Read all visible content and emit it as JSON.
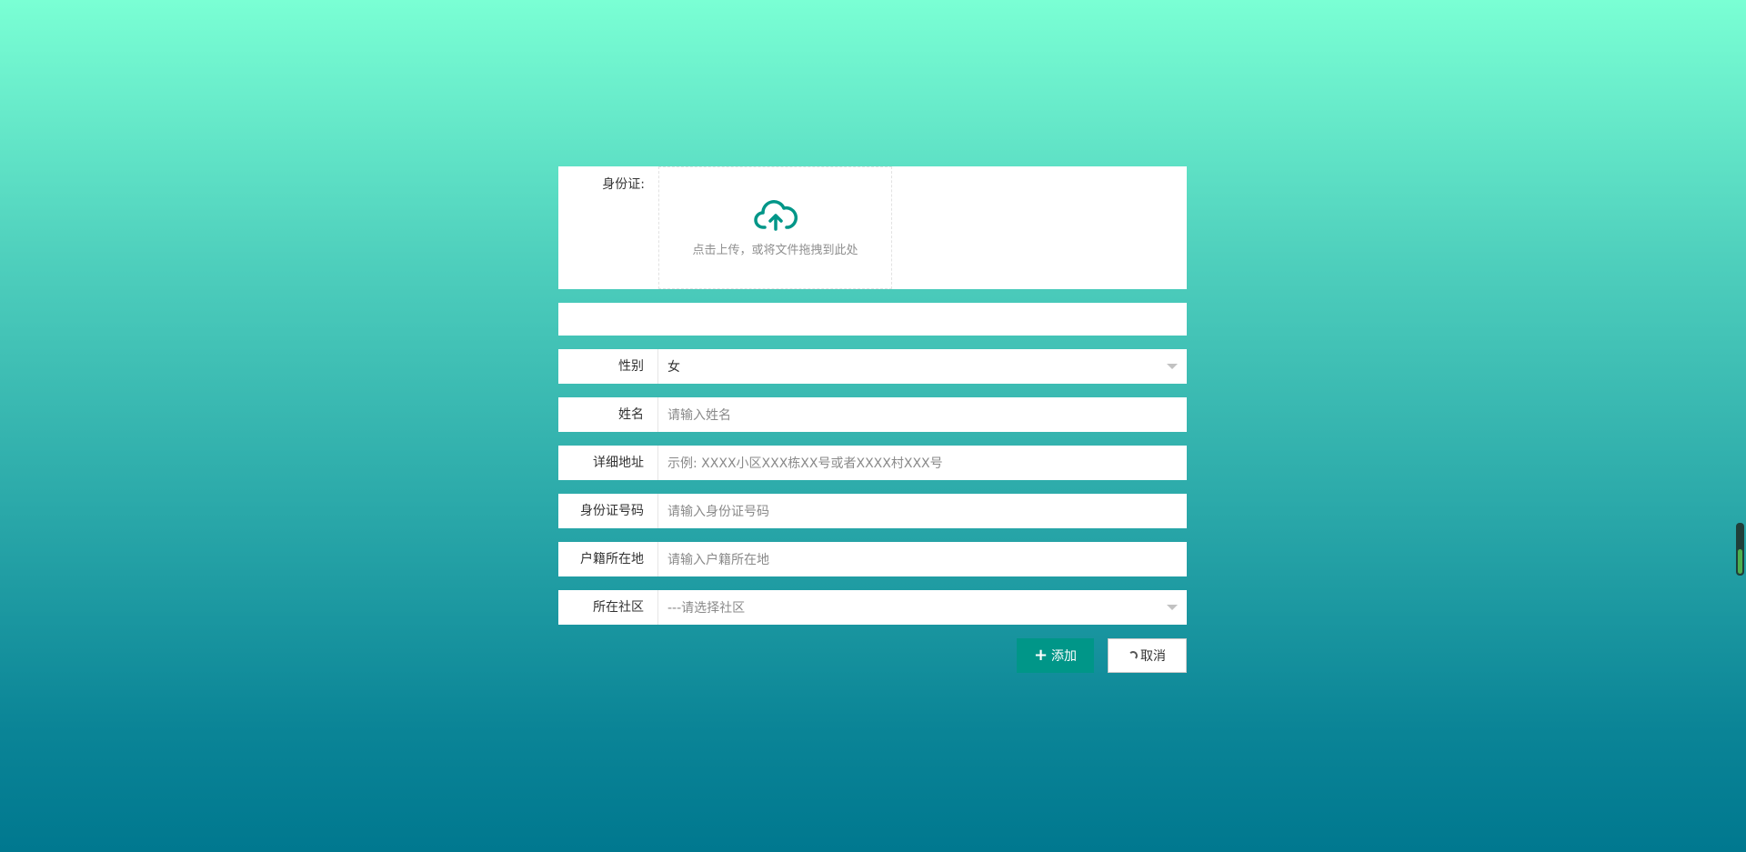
{
  "upload": {
    "label": "身份证:",
    "icon": "cloud-upload-icon",
    "hint": "点击上传，或将文件拖拽到此处",
    "icon_color": "#009688"
  },
  "form": {
    "gender": {
      "label": "性别",
      "value": "女"
    },
    "name": {
      "label": "姓名",
      "placeholder": "请输入姓名"
    },
    "address": {
      "label": "详细地址",
      "placeholder": "示例: XXXX小区XXX栋XX号或者XXXX村XXX号"
    },
    "id_number": {
      "label": "身份证号码",
      "placeholder": "请输入身份证号码"
    },
    "household": {
      "label": "户籍所在地",
      "placeholder": "请输入户籍所在地"
    },
    "community": {
      "label": "所在社区",
      "placeholder": "---请选择社区"
    }
  },
  "actions": {
    "add_label": "添加",
    "cancel_label": "取消"
  },
  "colors": {
    "accent": "#009688",
    "bg_top": "#7affd4",
    "bg_bottom": "#00788f"
  },
  "scroll_widget": {
    "fill_fraction": 0.46
  }
}
